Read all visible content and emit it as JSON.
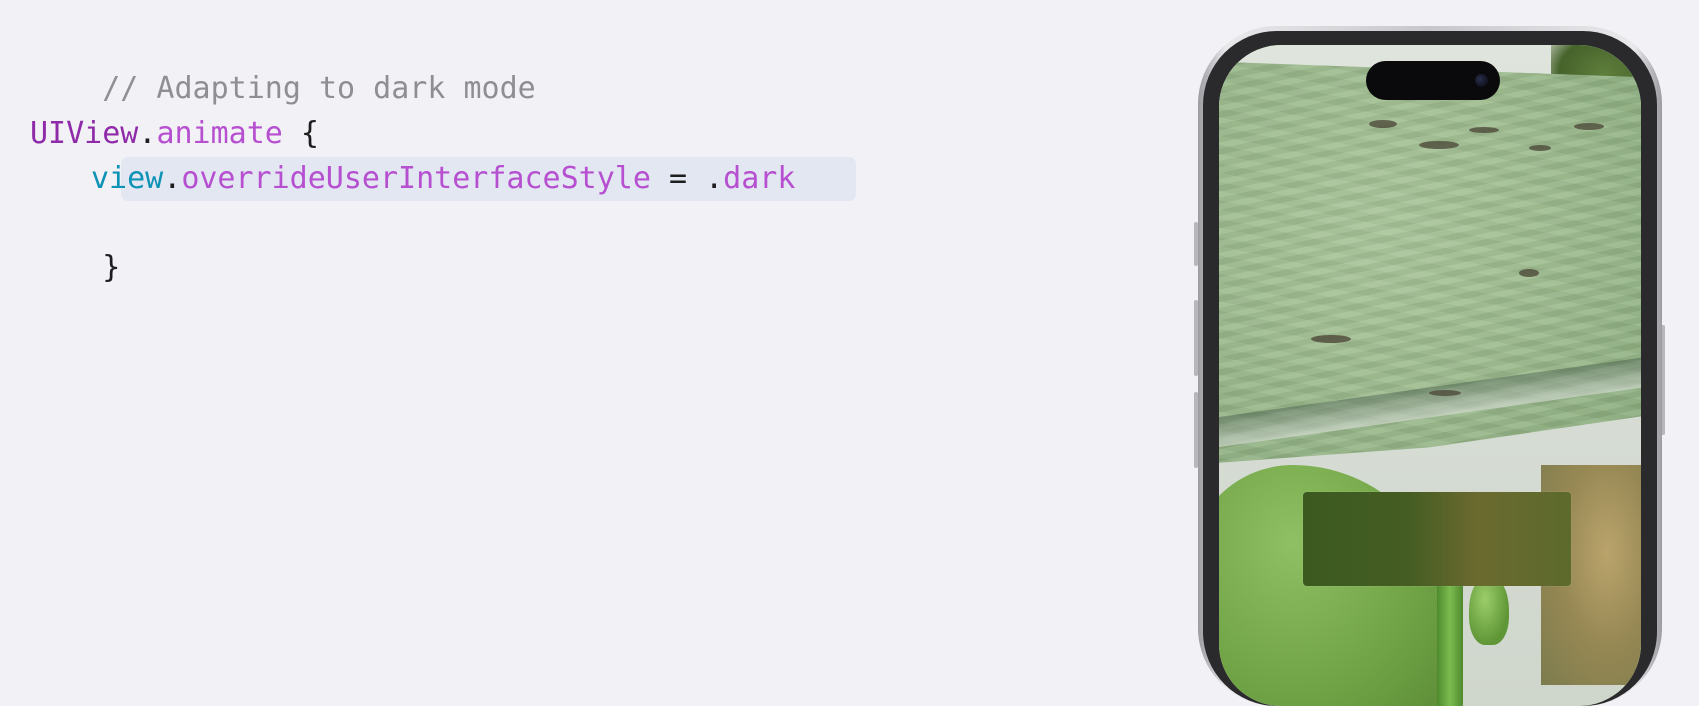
{
  "code": {
    "comment": "// Adapting to dark mode",
    "line1": {
      "type": "UIView",
      "dot": ".",
      "method": "animate",
      "brace": " {"
    },
    "line2": {
      "var": "view",
      "dot": ".",
      "prop": "overrideUserInterfaceStyle",
      "eq": " = .",
      "value": "dark"
    },
    "line3": {
      "brace": "}"
    }
  },
  "colors": {
    "background": "#f2f2f6",
    "comment": "#8e8e93",
    "type": "#8f2ba8",
    "method": "#b64fd0",
    "variable": "#0e93b6",
    "highlight": "#e2e7f2"
  },
  "phone": {
    "device": "iPhone",
    "screen_content": "lily-pad-photo"
  }
}
